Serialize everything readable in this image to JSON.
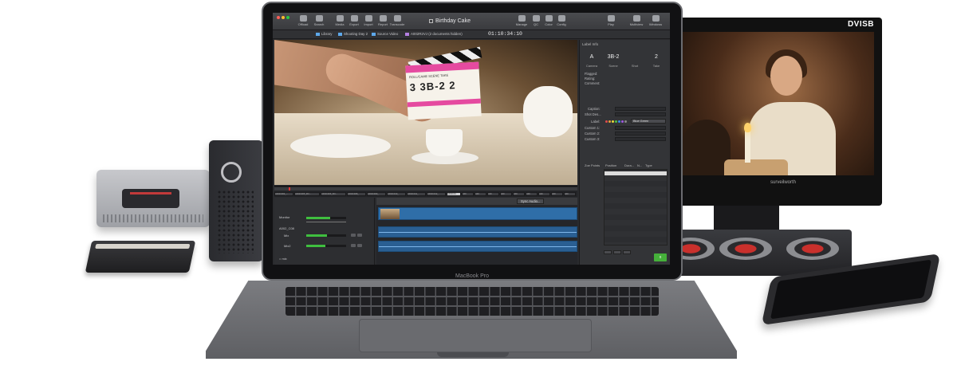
{
  "app": {
    "title": "Birthday Cake",
    "timecode": "01:10:34:10",
    "toolbar": {
      "left": [
        "Offload",
        "Search",
        "Media",
        "Export",
        "Import",
        "Report",
        "Transcode"
      ],
      "right": [
        "Manage",
        "QC",
        "Color",
        "Config",
        "Play",
        "Multiview",
        "Windows"
      ]
    },
    "path": {
      "library": "Library",
      "day": "Shooting Day 2",
      "source": "Source Video",
      "bin": "A002R2VJ (2 documents hidden)"
    },
    "inspector": {
      "header": "Label Info",
      "camera_value": "A",
      "scene_value": "3B-2",
      "shot_value": "",
      "take_value": "2",
      "camera_label": "Camera",
      "scene_label": "Scene",
      "shot_label": "Shot",
      "take_label": "Take",
      "flagged_label": "Flagged:",
      "rating_label": "Rating:",
      "comment_label": "Comment:",
      "caption_label": "Caption:",
      "shot_desc_label": "Shot Des...",
      "label_label": "Label:",
      "label_select": "Blue Green",
      "custom1_label": "Custom 1:",
      "custom2_label": "Custom 2:",
      "custom3_label": "Custom 3:",
      "zone_label": "Zoe Points",
      "zone_cols": [
        "Position",
        "Dura...",
        "N...",
        "Type"
      ]
    },
    "slate": {
      "header": "ROLL/CAME    SCENE    TAKE",
      "values": "3   3B-2    2"
    },
    "filmstrip_clips": [
      "A002C004_...",
      "A002C005_RO...",
      "A002C006_RO...",
      "A002C008_",
      "A002C009_",
      "A002C010_",
      "A002C011_",
      "A002C012_",
      "A002C01",
      "A00",
      "A00",
      "A00",
      "A00",
      "A00",
      "A00",
      "A00",
      "A00",
      "A00"
    ],
    "mixer": {
      "monitor": "Monitor",
      "track": "A002_C08",
      "mix": "Mix",
      "mix2": "Mix2",
      "foot": "= mix"
    },
    "timeline": {
      "sync_label": "Sync Audio..."
    },
    "status_badge": "0"
  },
  "hardware": {
    "monitor_brand": "DVISB",
    "monitor_sub": "surveilworth",
    "laptop_label": "MacBook Pro"
  },
  "colors": {
    "accent_blue": "#2f6ea8",
    "meter_green": "#3fbf3f",
    "slate_pink": "#e54aa0",
    "knob_red": "#c9302c"
  }
}
